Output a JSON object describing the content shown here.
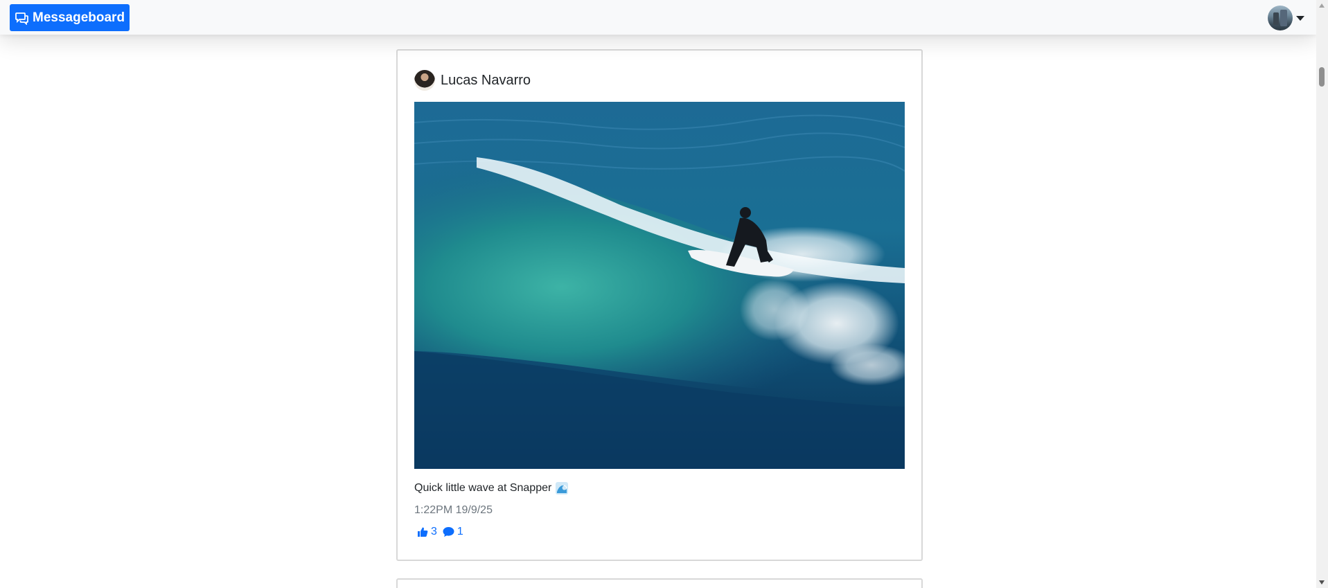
{
  "app": {
    "brand_label": "Messageboard",
    "brand_icon": "chat-bubbles-icon",
    "accent_color": "#0d6efd"
  },
  "navbar": {
    "user_avatar_icon": "user-avatar",
    "dropdown_icon": "caret-down-icon"
  },
  "post": {
    "author": "Lucas Navarro",
    "image_subject": "surfer riding a wave",
    "caption": "Quick little wave at Snapper",
    "caption_emoji_icon": "water-wave-icon",
    "timestamp": "1:22PM 19/9/25",
    "likes": "3",
    "comments": "1",
    "like_icon": "thumbs-up-icon",
    "comment_icon": "comment-bubble-icon"
  }
}
